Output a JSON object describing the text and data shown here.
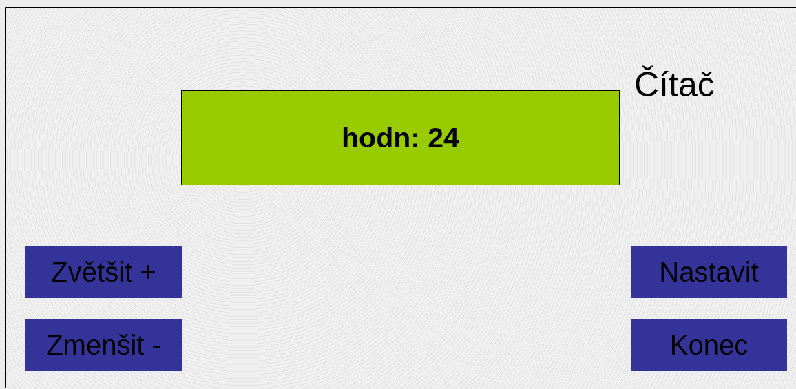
{
  "title": "Čítač",
  "display": {
    "text": "hodn: 24"
  },
  "left_buttons": [
    "Zvětšit +",
    "Zmenšit -"
  ],
  "right_buttons": [
    "Nastavit",
    "Konec"
  ]
}
